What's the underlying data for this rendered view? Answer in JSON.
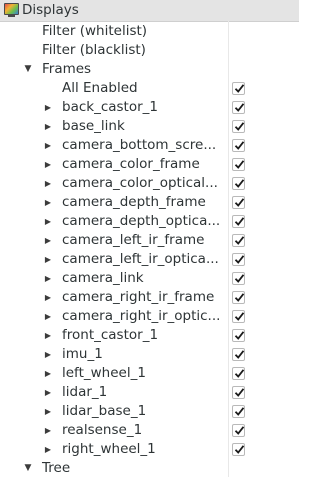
{
  "panel": {
    "title": "Displays",
    "icon": "monitor-icon"
  },
  "tree": {
    "filters": [
      {
        "label": "Filter (whitelist)"
      },
      {
        "label": "Filter (blacklist)"
      }
    ],
    "frames": {
      "label": "Frames",
      "expanded": true,
      "all_enabled": {
        "label": "All Enabled",
        "checked": true
      },
      "items": [
        {
          "label": "back_castor_1",
          "checked": true
        },
        {
          "label": "base_link",
          "checked": true
        },
        {
          "label": "camera_bottom_scre...",
          "checked": true
        },
        {
          "label": "camera_color_frame",
          "checked": true
        },
        {
          "label": "camera_color_optical...",
          "checked": true
        },
        {
          "label": "camera_depth_frame",
          "checked": true
        },
        {
          "label": "camera_depth_optica...",
          "checked": true
        },
        {
          "label": "camera_left_ir_frame",
          "checked": true
        },
        {
          "label": "camera_left_ir_optica...",
          "checked": true
        },
        {
          "label": "camera_link",
          "checked": true
        },
        {
          "label": "camera_right_ir_frame",
          "checked": true
        },
        {
          "label": "camera_right_ir_optic...",
          "checked": true
        },
        {
          "label": "front_castor_1",
          "checked": true
        },
        {
          "label": "imu_1",
          "checked": true
        },
        {
          "label": "left_wheel_1",
          "checked": true
        },
        {
          "label": "lidar_1",
          "checked": true
        },
        {
          "label": "lidar_base_1",
          "checked": true
        },
        {
          "label": "realsense_1",
          "checked": true
        },
        {
          "label": "right_wheel_1",
          "checked": true
        }
      ]
    },
    "tree_node": {
      "label": "Tree",
      "expanded": false
    }
  },
  "colors": {
    "header_bg": "#e4e4e4",
    "text": "#2e3436",
    "check_border": "#b9b9b9"
  }
}
